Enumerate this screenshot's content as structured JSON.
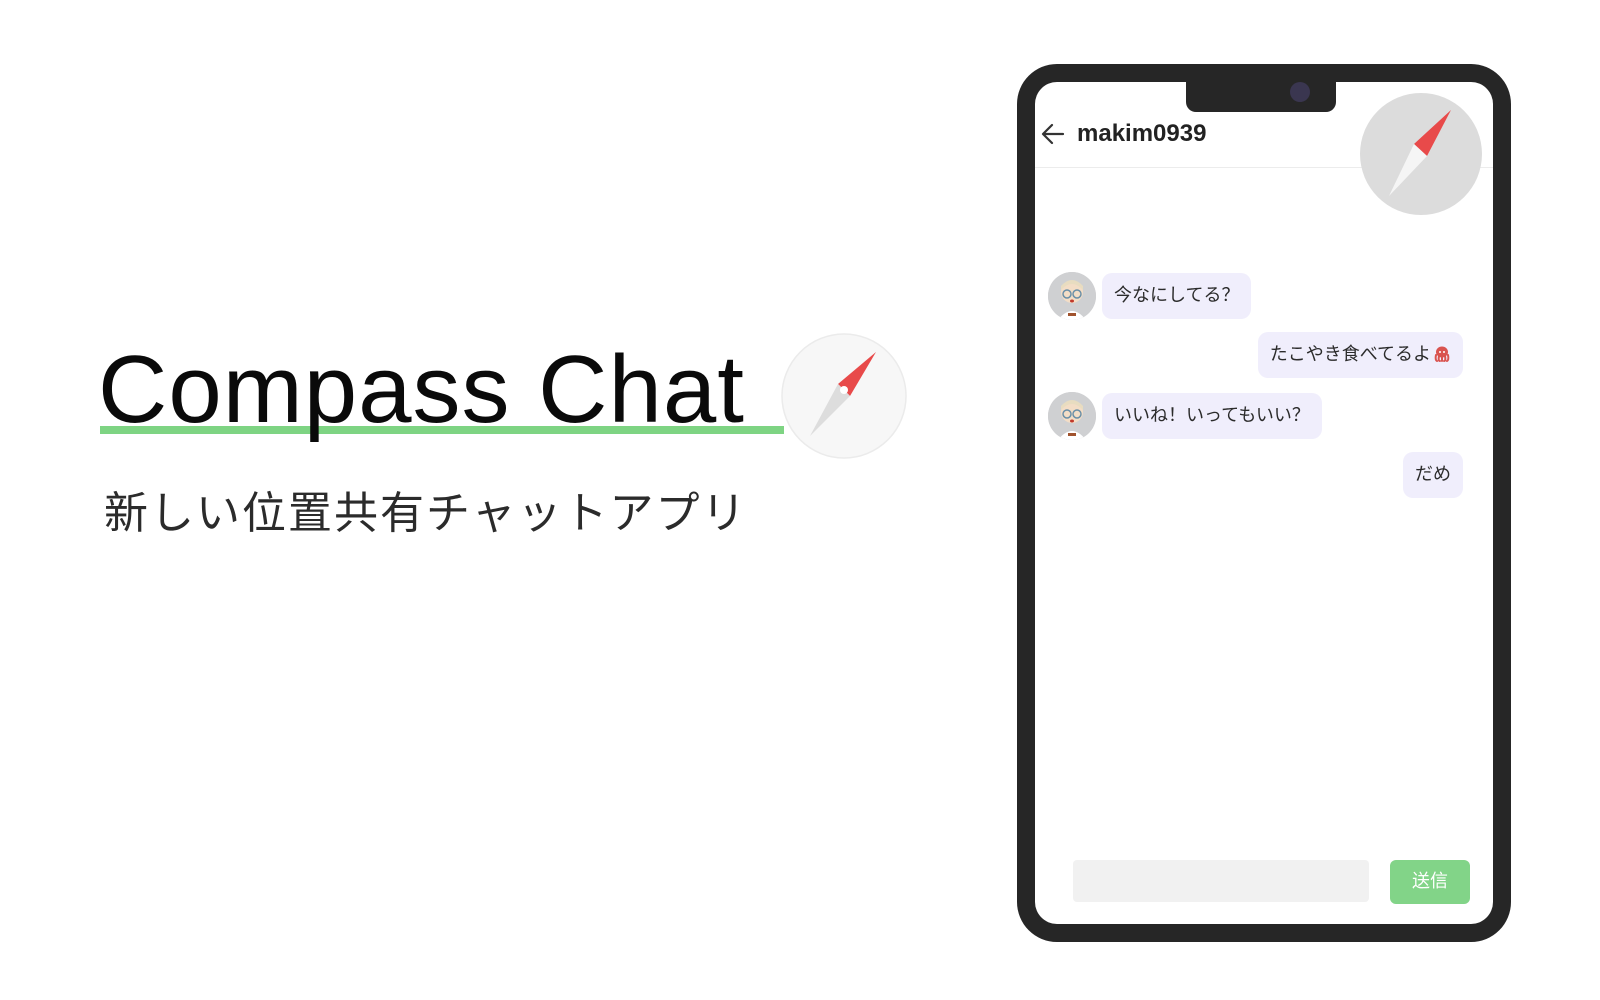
{
  "hero": {
    "title": "Compass Chat",
    "subtitle": "新しい位置共有チャットアプリ"
  },
  "chat": {
    "username": "makim0939",
    "messages": [
      {
        "side": "left",
        "text": "今なにしてる？"
      },
      {
        "side": "right",
        "text": "たこやき食べてるよ"
      },
      {
        "side": "left",
        "text": "いいね！いってもいい？"
      },
      {
        "side": "right",
        "text": "だめ"
      }
    ],
    "input_placeholder": "",
    "send_label": "送信"
  },
  "icons": {
    "back": "arrow-left-icon",
    "compass": "compass-icon",
    "avatar": "user-avatar",
    "octopus": "octopus-emoji"
  },
  "colors": {
    "accent_green": "#7ed483",
    "compass_red": "#e84a4a",
    "bubble_bg": "#f0eefc",
    "phone_frame": "#262626"
  }
}
